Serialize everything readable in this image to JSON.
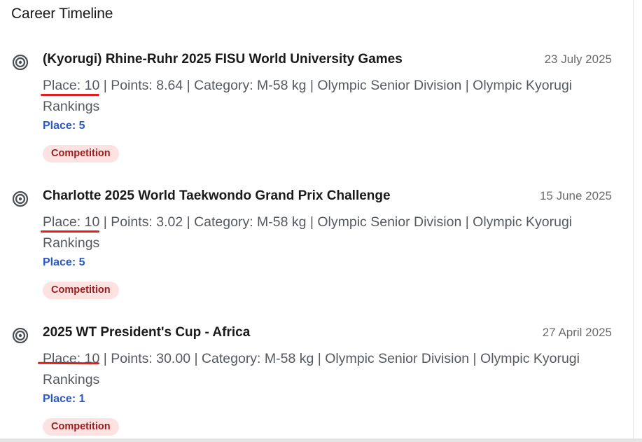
{
  "page": {
    "title": "Career Timeline"
  },
  "timeline": [
    {
      "event": "(Kyorugi) Rhine-Ruhr 2025 FISU World University Games",
      "date": "23 July 2025",
      "details": "Place: 10 | Points: 8.64 | Category: M-58 kg | Olympic Senior Division | Olympic Kyorugi Rankings",
      "place": "Place: 5",
      "badge": "Competition",
      "icon": "target-icon"
    },
    {
      "event": "Charlotte 2025 World Taekwondo Grand Prix Challenge",
      "date": "15 June 2025",
      "details": "Place: 10 | Points: 3.02 | Category: M-58 kg | Olympic Senior Division | Olympic Kyorugi Rankings",
      "place": "Place: 5",
      "badge": "Competition",
      "icon": "target-icon"
    },
    {
      "event": "2025 WT President's Cup - Africa",
      "date": "27 April 2025",
      "details": "Place: 10 | Points: 30.00 | Category: M-58 kg | Olympic Senior Division | Olympic Kyorugi Rankings",
      "place": "Place: 1",
      "badge": "Competition",
      "icon": "target-icon"
    }
  ],
  "colors": {
    "accent_blue": "#2b59c3",
    "badge_bg": "#fde2e2",
    "badge_text": "#9b1c1c",
    "annotation_red": "#dd1f1f"
  }
}
